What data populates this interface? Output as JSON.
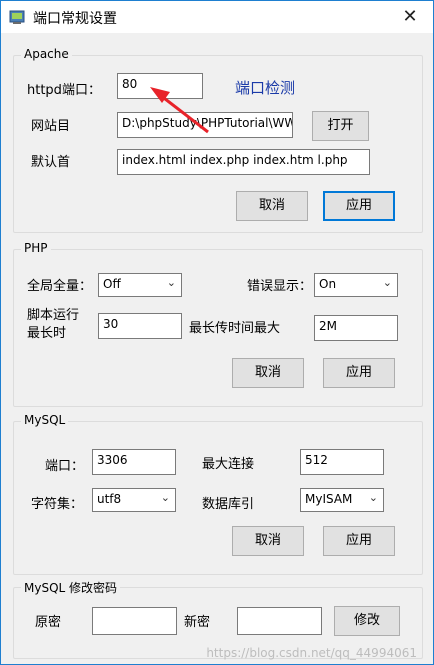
{
  "window": {
    "title": "端口常规设置",
    "close": "✕"
  },
  "apache": {
    "legend": "Apache",
    "port_label": "httpd端口：",
    "port_value": "80",
    "check_link": "端口检测",
    "site_label": "网站目",
    "site_value": "D:\\phpStudy\\PHPTutorial\\WW",
    "open_button": "打开",
    "default_label": "默认首",
    "default_value": "index.html index.php index.htm l.php",
    "cancel_button": "取消",
    "apply_button": "应用"
  },
  "php": {
    "legend": "PHP",
    "global_label": "全局全量：",
    "global_value": "Off",
    "error_label": "错误显示：",
    "error_value": "On",
    "script_time_label": "脚本运行\n最长时",
    "script_time_value": "30",
    "upload_label": "最长传时间最大",
    "upload_value": "2M",
    "cancel_button": "取消",
    "apply_button": "应用"
  },
  "mysql": {
    "legend": "MySQL",
    "port_label": "端口：",
    "port_value": "3306",
    "max_conn_label": "最大连接",
    "max_conn_value": "512",
    "charset_label": "字符集：",
    "charset_value": "utf8",
    "engine_label": "数据库引",
    "engine_value": "MyISAM",
    "cancel_button": "取消",
    "apply_button": "应用"
  },
  "password": {
    "legend": "MySQL 修改密码",
    "old_label": "原密",
    "old_value": "",
    "new_label": "新密",
    "new_value": "",
    "modify_button": "修改"
  },
  "watermark": "https://blog.csdn.net/qq_44994061",
  "colors": {
    "title_border": "#1e7fd0",
    "primary_border": "#0078d7",
    "link": "#1a3aa8",
    "arrow": "#e8232a"
  },
  "icons": {
    "app": "window-app-icon",
    "close": "close-icon",
    "chevron": "chevron-down-icon",
    "arrow": "red-arrow-annotation"
  }
}
